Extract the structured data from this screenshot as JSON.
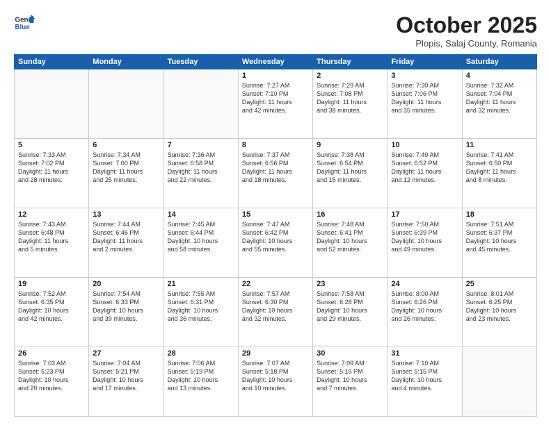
{
  "header": {
    "logo_general": "General",
    "logo_blue": "Blue",
    "title": "October 2025",
    "location": "Plopis, Salaj County, Romania"
  },
  "weekdays": [
    "Sunday",
    "Monday",
    "Tuesday",
    "Wednesday",
    "Thursday",
    "Friday",
    "Saturday"
  ],
  "weeks": [
    [
      {
        "day": "",
        "info": ""
      },
      {
        "day": "",
        "info": ""
      },
      {
        "day": "",
        "info": ""
      },
      {
        "day": "1",
        "info": "Sunrise: 7:27 AM\nSunset: 7:10 PM\nDaylight: 11 hours\nand 42 minutes."
      },
      {
        "day": "2",
        "info": "Sunrise: 7:29 AM\nSunset: 7:08 PM\nDaylight: 11 hours\nand 38 minutes."
      },
      {
        "day": "3",
        "info": "Sunrise: 7:30 AM\nSunset: 7:06 PM\nDaylight: 11 hours\nand 35 minutes."
      },
      {
        "day": "4",
        "info": "Sunrise: 7:32 AM\nSunset: 7:04 PM\nDaylight: 11 hours\nand 32 minutes."
      }
    ],
    [
      {
        "day": "5",
        "info": "Sunrise: 7:33 AM\nSunset: 7:02 PM\nDaylight: 11 hours\nand 28 minutes."
      },
      {
        "day": "6",
        "info": "Sunrise: 7:34 AM\nSunset: 7:00 PM\nDaylight: 11 hours\nand 25 minutes."
      },
      {
        "day": "7",
        "info": "Sunrise: 7:36 AM\nSunset: 6:58 PM\nDaylight: 11 hours\nand 22 minutes."
      },
      {
        "day": "8",
        "info": "Sunrise: 7:37 AM\nSunset: 6:56 PM\nDaylight: 11 hours\nand 18 minutes."
      },
      {
        "day": "9",
        "info": "Sunrise: 7:38 AM\nSunset: 6:54 PM\nDaylight: 11 hours\nand 15 minutes."
      },
      {
        "day": "10",
        "info": "Sunrise: 7:40 AM\nSunset: 6:52 PM\nDaylight: 11 hours\nand 12 minutes."
      },
      {
        "day": "11",
        "info": "Sunrise: 7:41 AM\nSunset: 6:50 PM\nDaylight: 11 hours\nand 8 minutes."
      }
    ],
    [
      {
        "day": "12",
        "info": "Sunrise: 7:43 AM\nSunset: 6:48 PM\nDaylight: 11 hours\nand 5 minutes."
      },
      {
        "day": "13",
        "info": "Sunrise: 7:44 AM\nSunset: 6:46 PM\nDaylight: 11 hours\nand 2 minutes."
      },
      {
        "day": "14",
        "info": "Sunrise: 7:45 AM\nSunset: 6:44 PM\nDaylight: 10 hours\nand 58 minutes."
      },
      {
        "day": "15",
        "info": "Sunrise: 7:47 AM\nSunset: 6:42 PM\nDaylight: 10 hours\nand 55 minutes."
      },
      {
        "day": "16",
        "info": "Sunrise: 7:48 AM\nSunset: 6:41 PM\nDaylight: 10 hours\nand 52 minutes."
      },
      {
        "day": "17",
        "info": "Sunrise: 7:50 AM\nSunset: 6:39 PM\nDaylight: 10 hours\nand 49 minutes."
      },
      {
        "day": "18",
        "info": "Sunrise: 7:51 AM\nSunset: 6:37 PM\nDaylight: 10 hours\nand 45 minutes."
      }
    ],
    [
      {
        "day": "19",
        "info": "Sunrise: 7:52 AM\nSunset: 6:35 PM\nDaylight: 10 hours\nand 42 minutes."
      },
      {
        "day": "20",
        "info": "Sunrise: 7:54 AM\nSunset: 6:33 PM\nDaylight: 10 hours\nand 39 minutes."
      },
      {
        "day": "21",
        "info": "Sunrise: 7:55 AM\nSunset: 6:31 PM\nDaylight: 10 hours\nand 36 minutes."
      },
      {
        "day": "22",
        "info": "Sunrise: 7:57 AM\nSunset: 6:30 PM\nDaylight: 10 hours\nand 32 minutes."
      },
      {
        "day": "23",
        "info": "Sunrise: 7:58 AM\nSunset: 6:28 PM\nDaylight: 10 hours\nand 29 minutes."
      },
      {
        "day": "24",
        "info": "Sunrise: 8:00 AM\nSunset: 6:26 PM\nDaylight: 10 hours\nand 26 minutes."
      },
      {
        "day": "25",
        "info": "Sunrise: 8:01 AM\nSunset: 6:25 PM\nDaylight: 10 hours\nand 23 minutes."
      }
    ],
    [
      {
        "day": "26",
        "info": "Sunrise: 7:03 AM\nSunset: 5:23 PM\nDaylight: 10 hours\nand 20 minutes."
      },
      {
        "day": "27",
        "info": "Sunrise: 7:04 AM\nSunset: 5:21 PM\nDaylight: 10 hours\nand 17 minutes."
      },
      {
        "day": "28",
        "info": "Sunrise: 7:06 AM\nSunset: 5:19 PM\nDaylight: 10 hours\nand 13 minutes."
      },
      {
        "day": "29",
        "info": "Sunrise: 7:07 AM\nSunset: 5:18 PM\nDaylight: 10 hours\nand 10 minutes."
      },
      {
        "day": "30",
        "info": "Sunrise: 7:09 AM\nSunset: 5:16 PM\nDaylight: 10 hours\nand 7 minutes."
      },
      {
        "day": "31",
        "info": "Sunrise: 7:10 AM\nSunset: 5:15 PM\nDaylight: 10 hours\nand 4 minutes."
      },
      {
        "day": "",
        "info": ""
      }
    ]
  ]
}
